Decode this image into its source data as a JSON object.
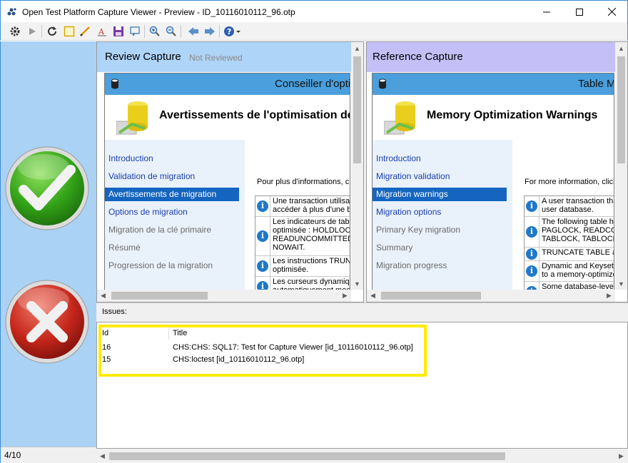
{
  "window": {
    "title": "Open Test Platform Capture Viewer - Preview - ID_10116010112_96.otp"
  },
  "toolbar": {
    "icons": [
      "settings-icon",
      "play-icon",
      "refresh-icon",
      "rectangle-icon",
      "pen-icon",
      "text-icon",
      "save-icon",
      "comment-icon",
      "zoom-in-icon",
      "zoom-out-icon",
      "back-icon",
      "forward-icon",
      "help-icon"
    ]
  },
  "left_panel": {
    "counter": "4/10"
  },
  "review": {
    "title": "Review Capture",
    "status": "Not Reviewed",
    "wizard_title": "Conseiller d'opti",
    "heading": "Avertissements de l'optimisation de",
    "steps": [
      {
        "label": "Introduction",
        "style": "link"
      },
      {
        "label": "Validation de migration",
        "style": "link"
      },
      {
        "label": "Avertissements de migration",
        "style": "sel"
      },
      {
        "label": "Options de migration",
        "style": "link"
      },
      {
        "label": "Migration de la clé primaire",
        "style": "grey"
      },
      {
        "label": "Résumé",
        "style": "grey"
      },
      {
        "label": "Progression de la migration",
        "style": "grey"
      }
    ],
    "more_info": "Pour plus d'informations, clic",
    "messages": [
      "Une transaction utilisat\naccéder à plus d'une b",
      "Les indicateurs de table\noptimisée : HOLDLOCK\nREADUNCOMMITTED\nNOWAIT.",
      "Les instructions TRUN\noptimisée.",
      "Les curseurs dynamiqu\nautomatiquement modifi"
    ]
  },
  "reference": {
    "title": "Reference Capture",
    "wizard_title": "Table M",
    "heading": "Memory Optimization Warnings",
    "steps": [
      {
        "label": "Introduction",
        "style": "link"
      },
      {
        "label": "Migration validation",
        "style": "link"
      },
      {
        "label": "Migration warnings",
        "style": "sel"
      },
      {
        "label": "Migration options",
        "style": "link"
      },
      {
        "label": "Primary Key migration",
        "style": "grey"
      },
      {
        "label": "Summary",
        "style": "grey"
      },
      {
        "label": "Migration progress",
        "style": "grey"
      }
    ],
    "more_info": "For more information, click",
    "messages": [
      "A user transaction tha\nuser database.",
      "The following table hi\nPAGLOCK, READCO\nTABLOCK, TABLOCK",
      "TRUNCATE TABLE a",
      "Dynamic and Keyset c\nto a memory-optimize",
      "Some database-level\ndetails on these featu"
    ]
  },
  "issues": {
    "label": "Issues:",
    "columns": {
      "id": "Id",
      "title": "Title"
    },
    "rows": [
      {
        "id": "16",
        "title": "CHS:CHS: SQL17: Test for Capture Viewer [id_10116010112_96.otp]"
      },
      {
        "id": "15",
        "title": "CHS:loctest [id_10116010112_96.otp]"
      }
    ]
  },
  "colors": {
    "review_header": "#aed4f7",
    "reference_header": "#c4c0f7",
    "wizard_bar": "#4a9fdc",
    "selected_step": "#1565c0",
    "highlight": "#ffeb00"
  }
}
